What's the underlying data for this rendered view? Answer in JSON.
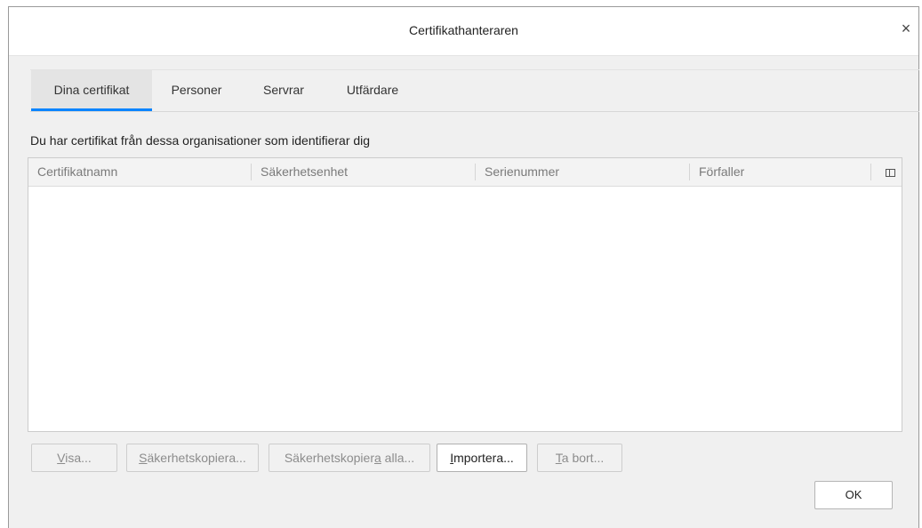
{
  "window": {
    "title": "Certifikathanteraren",
    "close_glyph": "×"
  },
  "tabs": [
    {
      "label": "Dina certifikat",
      "active": true
    },
    {
      "label": "Personer",
      "active": false
    },
    {
      "label": "Servrar",
      "active": false
    },
    {
      "label": "Utfärdare",
      "active": false
    }
  ],
  "description": "Du har certifikat från dessa organisationer som identifierar dig",
  "table": {
    "columns": [
      "Certifikatnamn",
      "Säkerhetsenhet",
      "Serienummer",
      "Förfaller"
    ],
    "column_picker_icon": "column-picker-icon",
    "rows": []
  },
  "buttons": {
    "view": {
      "before": "",
      "accel": "V",
      "after": "isa...",
      "enabled": false
    },
    "backup": {
      "before": "",
      "accel": "S",
      "after": "äkerhetskopiera...",
      "enabled": false
    },
    "backup_all": {
      "before": "Säkerhetskopier",
      "accel": "a",
      "after": " alla...",
      "enabled": false
    },
    "import": {
      "before": "",
      "accel": "I",
      "after": "mportera...",
      "enabled": true
    },
    "delete": {
      "before": "",
      "accel": "T",
      "after": "a bort...",
      "enabled": false
    }
  },
  "ok_label": "OK",
  "colors": {
    "accent": "#0a84ff",
    "dialog_bg": "#f0f0f0"
  }
}
